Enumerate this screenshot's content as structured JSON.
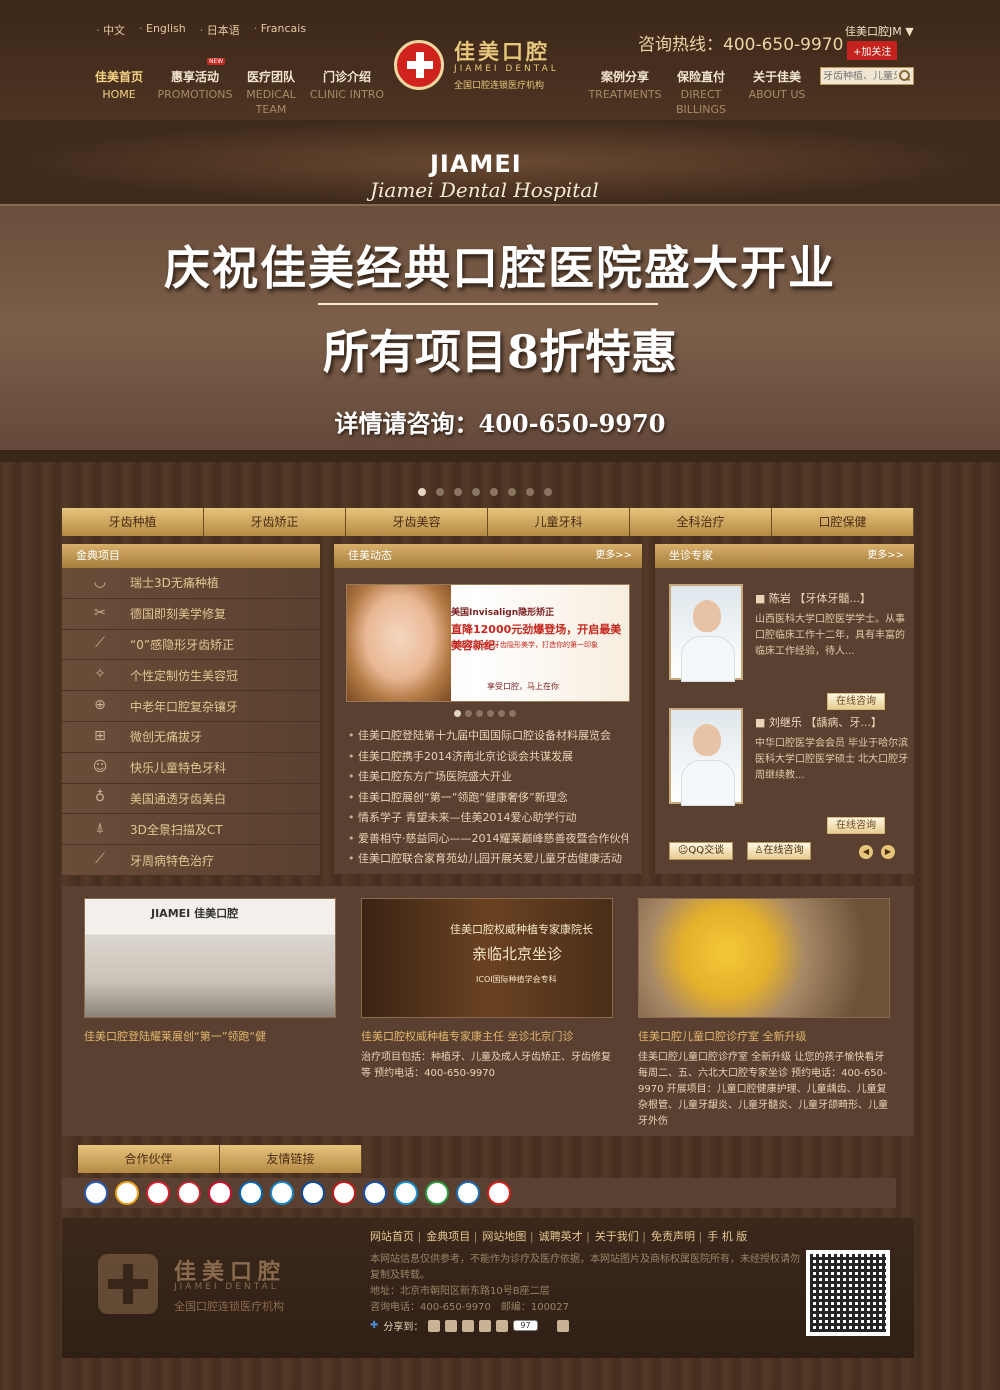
{
  "languages": [
    "中文",
    "English",
    "日本语",
    "Francais"
  ],
  "nav_left": [
    {
      "cn": "佳美首页",
      "en": "HOME"
    },
    {
      "cn": "惠享活动",
      "en": "PROMOTIONS",
      "tag": "NEW"
    },
    {
      "cn": "医疗团队",
      "en": "MEDICAL TEAM"
    },
    {
      "cn": "门诊介绍",
      "en": "CLINIC INTRO"
    }
  ],
  "nav_right": [
    {
      "cn": "案例分享",
      "en": "TREATMENTS"
    },
    {
      "cn": "保险直付",
      "en": "DIRECT BILLINGS"
    },
    {
      "cn": "关于佳美",
      "en": "ABOUT US"
    }
  ],
  "logo": {
    "name": "佳美口腔",
    "en": "JIAMEI DENTAL",
    "sub": "全国口腔连锁医疗机构"
  },
  "hotline": "咨询热线：400-650-9970",
  "account": "佳美口腔JM",
  "follow_label": "+加关注",
  "search_placeholder": "牙齿种植、儿童牙",
  "brand": {
    "en": "JIAMEI",
    "script": "Jiamei Dental Hospital"
  },
  "hero": {
    "line1": "庆祝佳美经典口腔医院盛大开业",
    "line2": "所有项目8折特惠",
    "line3": "详情请咨询：400-650-9970"
  },
  "categories": [
    "牙齿种植",
    "牙齿矫正",
    "牙齿美容",
    "儿童牙科",
    "全科治疗",
    "口腔保健"
  ],
  "classic": {
    "title": "金典项目",
    "items": [
      {
        "icon": "tooth-icon",
        "label": "瑞士3D无痛种植"
      },
      {
        "icon": "tweezers-icon",
        "label": "德国即刻美学修复"
      },
      {
        "icon": "brace-icon",
        "label": "“0”感隐形牙齿矫正"
      },
      {
        "icon": "sparkle-icon",
        "label": "个性定制仿生美容冠"
      },
      {
        "icon": "plus-circle-icon",
        "label": "中老年口腔复杂镶牙"
      },
      {
        "icon": "plus-square-icon",
        "label": "微创无痛拔牙"
      },
      {
        "icon": "bear-icon",
        "label": "快乐儿童特色牙科"
      },
      {
        "icon": "microscope-icon",
        "label": "美国通透牙齿美白"
      },
      {
        "icon": "scanner-icon",
        "label": "3D全景扫描及CT"
      },
      {
        "icon": "probe-icon",
        "label": "牙周病特色治疗"
      }
    ]
  },
  "news": {
    "title": "佳美动态",
    "more": "更多>>",
    "banner": {
      "h1": "美国Invisalign隐形矫正",
      "h2": "直降12000元劲爆登场，开启最美美容新纪",
      "h3": "呼唤吗？完美牙齿隐形美学，打造你的第一印象",
      "h4": "享受口腔，马上在你"
    },
    "items": [
      "佳美口腔登陆第十九届中国国际口腔设备材料展览会",
      "佳美口腔携手2014济南北京论谈会共谋发展",
      "佳美口腔东方广场医院盛大开业",
      "佳美口腔展创“第一”领跑“健康奢侈”新理念",
      "情系学子 青望未来—佳美2014爱心助学行动",
      "爱善相守·慈益同心——2014耀莱巅峰慈善夜暨合作伙伴签",
      "佳美口腔联合家育苑幼儿园开展关爱儿童牙齿健康活动"
    ]
  },
  "experts": {
    "title": "坐诊专家",
    "more": "更多>>",
    "consult_label": "在线咨询",
    "doctors": [
      {
        "name": "陈岩",
        "spec": "【牙体牙髓...】",
        "desc": "山西医科大学口腔医学学士。从事口腔临床工作十二年，具有丰富的临床工作经验，待人..."
      },
      {
        "name": "刘继乐",
        "spec": "【龋病、牙...】",
        "desc": "中华口腔医学会会员 毕业于哈尔滨医科大学口腔医学硕士 北大口腔牙周继续教..."
      }
    ],
    "qq_label": "QQ交谈",
    "online_label": "在线咨询"
  },
  "cards": [
    {
      "title": "佳美口腔登陆耀莱展创“第一”领跑“健",
      "desc": "",
      "img": {
        "t1": "JIAMEI 佳美口腔"
      }
    },
    {
      "title": "佳美口腔权威种植专家康主任 坐诊北京门诊",
      "desc": "治疗项目包括：种植牙、儿童及成人牙齿矫正、牙齿修复等 预约电话：400-650-9970",
      "img": {
        "t1": "佳美口腔权威种植专家康院长",
        "t2": "亲临北京坐诊",
        "t3": "ICOI国际种植学会专科"
      }
    },
    {
      "title": "佳美口腔儿童口腔诊疗室 全新升级",
      "desc": "佳美口腔儿童口腔诊疗室 全新升级 让您的孩子愉快看牙 每周二、五、六北大口腔专家坐诊 预约电话：400-650-9970 开展项目：儿童口腔健康护理、儿童龋齿、儿童复杂根管、儿童牙龈炎、儿童牙髓炎、儿童牙颌畸形、儿童牙外伤",
      "img": {}
    }
  ],
  "partner_tabs": [
    "合作伙伴",
    "友情链接"
  ],
  "footer": {
    "name": "佳美口腔",
    "en": "JIAMEI DENTAL",
    "sub": "全国口腔连锁医疗机构",
    "links": [
      "网站首页",
      "金典项目",
      "网站地图",
      "诚聘英才",
      "关于我们",
      "免责声明",
      "手 机 版"
    ],
    "notice": "本网站信息仅供参考，不能作为诊疗及医疗依据，本网站图片及商标权属医院所有，未经授权请勿复制及转载。",
    "address": "地址：北京市朝阳区新东路10号B座二层",
    "phone": "咨询电话：400-650-9970　邮编：100027",
    "share": "分享到：",
    "share_count": "97"
  }
}
